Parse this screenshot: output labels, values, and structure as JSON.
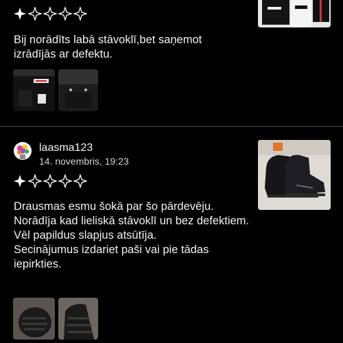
{
  "reviews": [
    {
      "username": "",
      "date": "",
      "rating": 1,
      "text": "Bij norādīts labā stāvoklī,bet saņemot izrādījās ar defektu.",
      "item_image": "fila-clothing-photo",
      "photos": [
        "fila-clothing-detail-photo",
        "black-pants-pocket-photo"
      ]
    },
    {
      "username": "laasma123",
      "date": "14. novembris, 19:23",
      "rating": 1,
      "text": "Drausmas esmu šokā par šo pārdevēju.\nNorādīja kad lieliskā stāvoklī un bez defektiem.\nVēl papildus slapjus atsūtīja.\nSecinājumus izdariet paši vai pie tādas iepirkties.",
      "item_image": "black-hiking-boots-photo",
      "photos": [
        "worn-sole-photo",
        "worn-sole-closeup-photo"
      ]
    }
  ],
  "colors": {
    "background": "#000000",
    "star_outline": "#ffffff",
    "divider": "#4a4a4a"
  }
}
